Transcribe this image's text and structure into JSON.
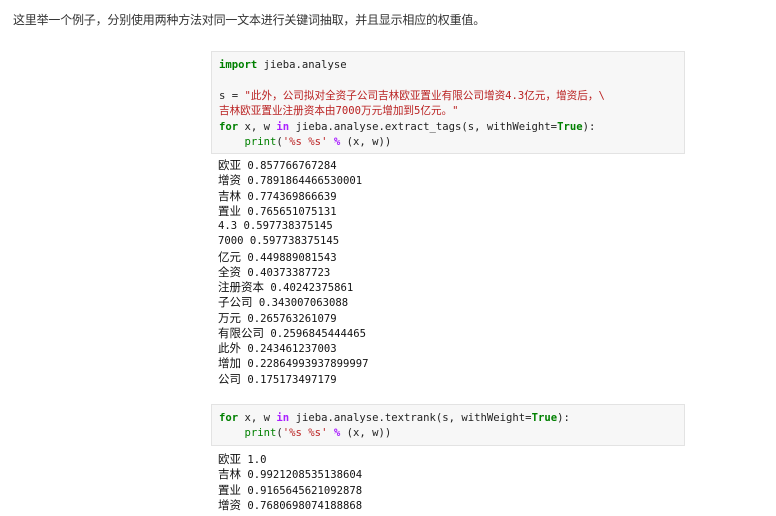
{
  "intro_text": "这里举一个例子，分别使用两种方法对同一文本进行关键词抽取，并且显示相应的权重值。",
  "cell1": {
    "line1_kw": "import",
    "line1_rest": " jieba.analyse",
    "line2_var": "s",
    "line2_eq": " = ",
    "line2_str": "\"此外，公司拟对全资子公司吉林欧亚置业有限公司增资4.3亿元，增资后，\\",
    "line3_str": "吉林欧亚置业注册资本由7000万元增加到5亿元。\"",
    "line4_for": "for",
    "line4_mid": " x, w ",
    "line4_in": "in",
    "line4_call": " jieba.analyse.extract_tags(s, withWeight=",
    "line4_true": "True",
    "line4_end": "):",
    "line5_indent": "    ",
    "line5_print": "print",
    "line5_open": "(",
    "line5_str": "'%s %s'",
    "line5_sp": " ",
    "line5_pct": "%",
    "line5_end": " (x, w))"
  },
  "output1": [
    {
      "word": "欧亚",
      "weight": " 0.857766767284"
    },
    {
      "word": "增资",
      "weight": " 0.7891864466530001"
    },
    {
      "word": "吉林",
      "weight": " 0.774369866639"
    },
    {
      "word": "置业",
      "weight": " 0.765651075131"
    },
    {
      "word": "4.3",
      "weight": " 0.597738375145"
    },
    {
      "word": "7000",
      "weight": " 0.597738375145"
    },
    {
      "word": "亿元",
      "weight": " 0.449889081543"
    },
    {
      "word": "全资",
      "weight": " 0.40373387723"
    },
    {
      "word": "注册资本",
      "weight": " 0.40242375861"
    },
    {
      "word": "子公司",
      "weight": " 0.343007063088"
    },
    {
      "word": "万元",
      "weight": " 0.265763261079"
    },
    {
      "word": "有限公司",
      "weight": " 0.2596845444465"
    },
    {
      "word": "此外",
      "weight": " 0.243461237003"
    },
    {
      "word": "增加",
      "weight": " 0.22864993937899997"
    },
    {
      "word": "公司",
      "weight": " 0.175173497179"
    }
  ],
  "cell2": {
    "line1_for": "for",
    "line1_mid": " x, w ",
    "line1_in": "in",
    "line1_call": " jieba.analyse.textrank(s, withWeight=",
    "line1_true": "True",
    "line1_end": "):",
    "line2_indent": "    ",
    "line2_print": "print",
    "line2_open": "(",
    "line2_str": "'%s %s'",
    "line2_sp": " ",
    "line2_pct": "%",
    "line2_end": " (x, w))"
  },
  "output2": [
    {
      "word": "欧亚",
      "weight": " 1.0"
    },
    {
      "word": "吉林",
      "weight": " 0.9921208535138604"
    },
    {
      "word": "置业",
      "weight": " 0.9165645621092878"
    },
    {
      "word": "增资",
      "weight": " 0.7680698074188868"
    }
  ]
}
